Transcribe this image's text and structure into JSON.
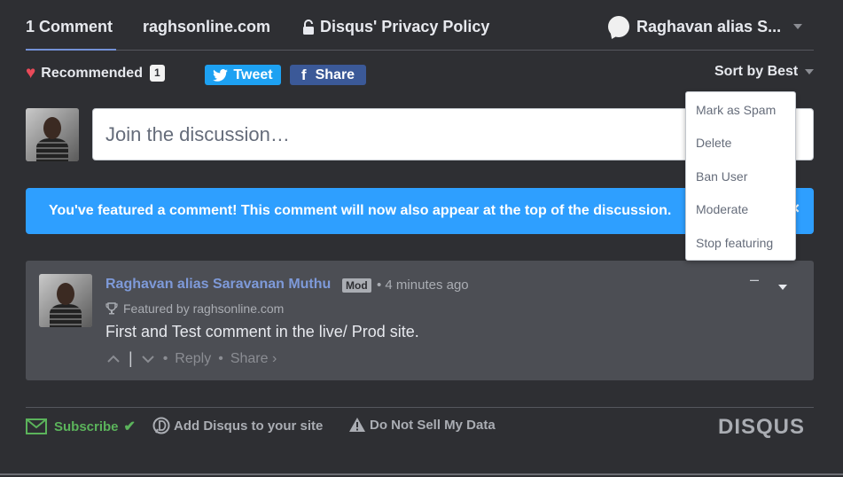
{
  "nav": {
    "comments_tab": "1 Comment",
    "site_tab": "raghsonline.com",
    "privacy_tab": "Disqus' Privacy Policy",
    "user_name": "Raghavan alias S..."
  },
  "toolbar": {
    "recommended_label": "Recommended",
    "recommended_count": "1",
    "tweet_label": "Tweet",
    "share_label": "Share",
    "sort_label": "Sort by Best"
  },
  "composer": {
    "placeholder": "Join the discussion…"
  },
  "banner": {
    "message": "You've featured a comment! This comment will now also appear at the top of the discussion.",
    "close_glyph": "×"
  },
  "comment": {
    "author": "Raghavan alias Saravanan Muthu",
    "badge": "Mod",
    "time": "• 4 minutes ago",
    "featured_by": "Featured by raghsonline.com",
    "text": "First and Test comment in the live/ Prod site.",
    "separator": "•",
    "reply_label": "Reply",
    "share_label": "Share ›",
    "collapse_glyph": "–"
  },
  "moderation_menu": {
    "items": [
      "Mark as Spam",
      "Delete",
      "Ban User",
      "Moderate",
      "Stop featuring"
    ]
  },
  "footer": {
    "subscribe_label": "Subscribe",
    "add_disqus_label": "Add Disqus to your site",
    "do_not_sell_label": "Do Not Sell My Data",
    "logo_text": "DISQUS"
  },
  "colors": {
    "background": "#2e2f33",
    "accent_blue": "#2e9fff",
    "author_link": "#7e9ad9",
    "tweet": "#1da1f2",
    "facebook": "#3b5998",
    "subscribe_green": "#5bb35b",
    "heart": "#e94a59"
  }
}
